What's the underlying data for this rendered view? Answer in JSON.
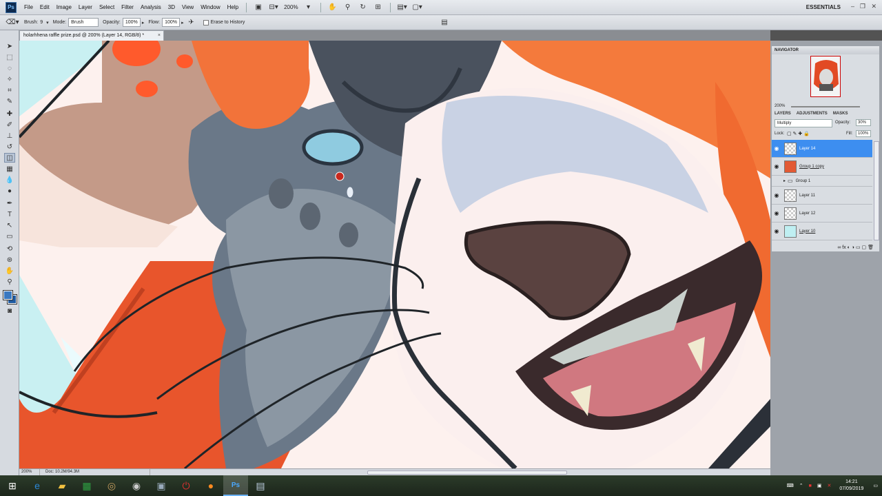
{
  "app": {
    "logo": "Ps",
    "menus": [
      "File",
      "Edit",
      "Image",
      "Layer",
      "Select",
      "Filter",
      "Analysis",
      "3D",
      "View",
      "Window",
      "Help"
    ],
    "zoom_dropdown": "200%",
    "workspace": "ESSENTIALS"
  },
  "options": {
    "brush_label": "Brush:",
    "brush_size": "9",
    "mode_label": "Mode:",
    "mode_value": "Brush",
    "opacity_label": "Opacity:",
    "opacity_value": "100%",
    "flow_label": "Flow:",
    "flow_value": "100%",
    "erase_history_label": "Erase to History"
  },
  "document": {
    "tab_title": "holarhhena raffle prize.psd @ 200% (Layer 14, RGB/8) *",
    "status_zoom": "200%",
    "status_doc": "Doc: 10.2M/94.3M"
  },
  "navigator": {
    "title": "NAVIGATOR",
    "zoom": "200%"
  },
  "layers_panel": {
    "tabs": [
      "LAYERS",
      "ADJUSTMENTS",
      "MASKS"
    ],
    "blend_mode": "Multiply",
    "opacity_label": "Opacity:",
    "opacity_value": "30%",
    "lock_label": "Lock:",
    "fill_label": "Fill:",
    "fill_value": "100%",
    "layers": [
      {
        "name": "Layer 14",
        "selected": true
      },
      {
        "name": "Group 1 copy",
        "selected": false
      },
      {
        "name": "Group 1",
        "selected": false
      },
      {
        "name": "Layer 11",
        "selected": false
      },
      {
        "name": "Layer 12",
        "selected": false
      },
      {
        "name": "Layer 10",
        "selected": false
      }
    ]
  },
  "taskbar": {
    "time": "14:21",
    "date": "07/09/2019"
  }
}
